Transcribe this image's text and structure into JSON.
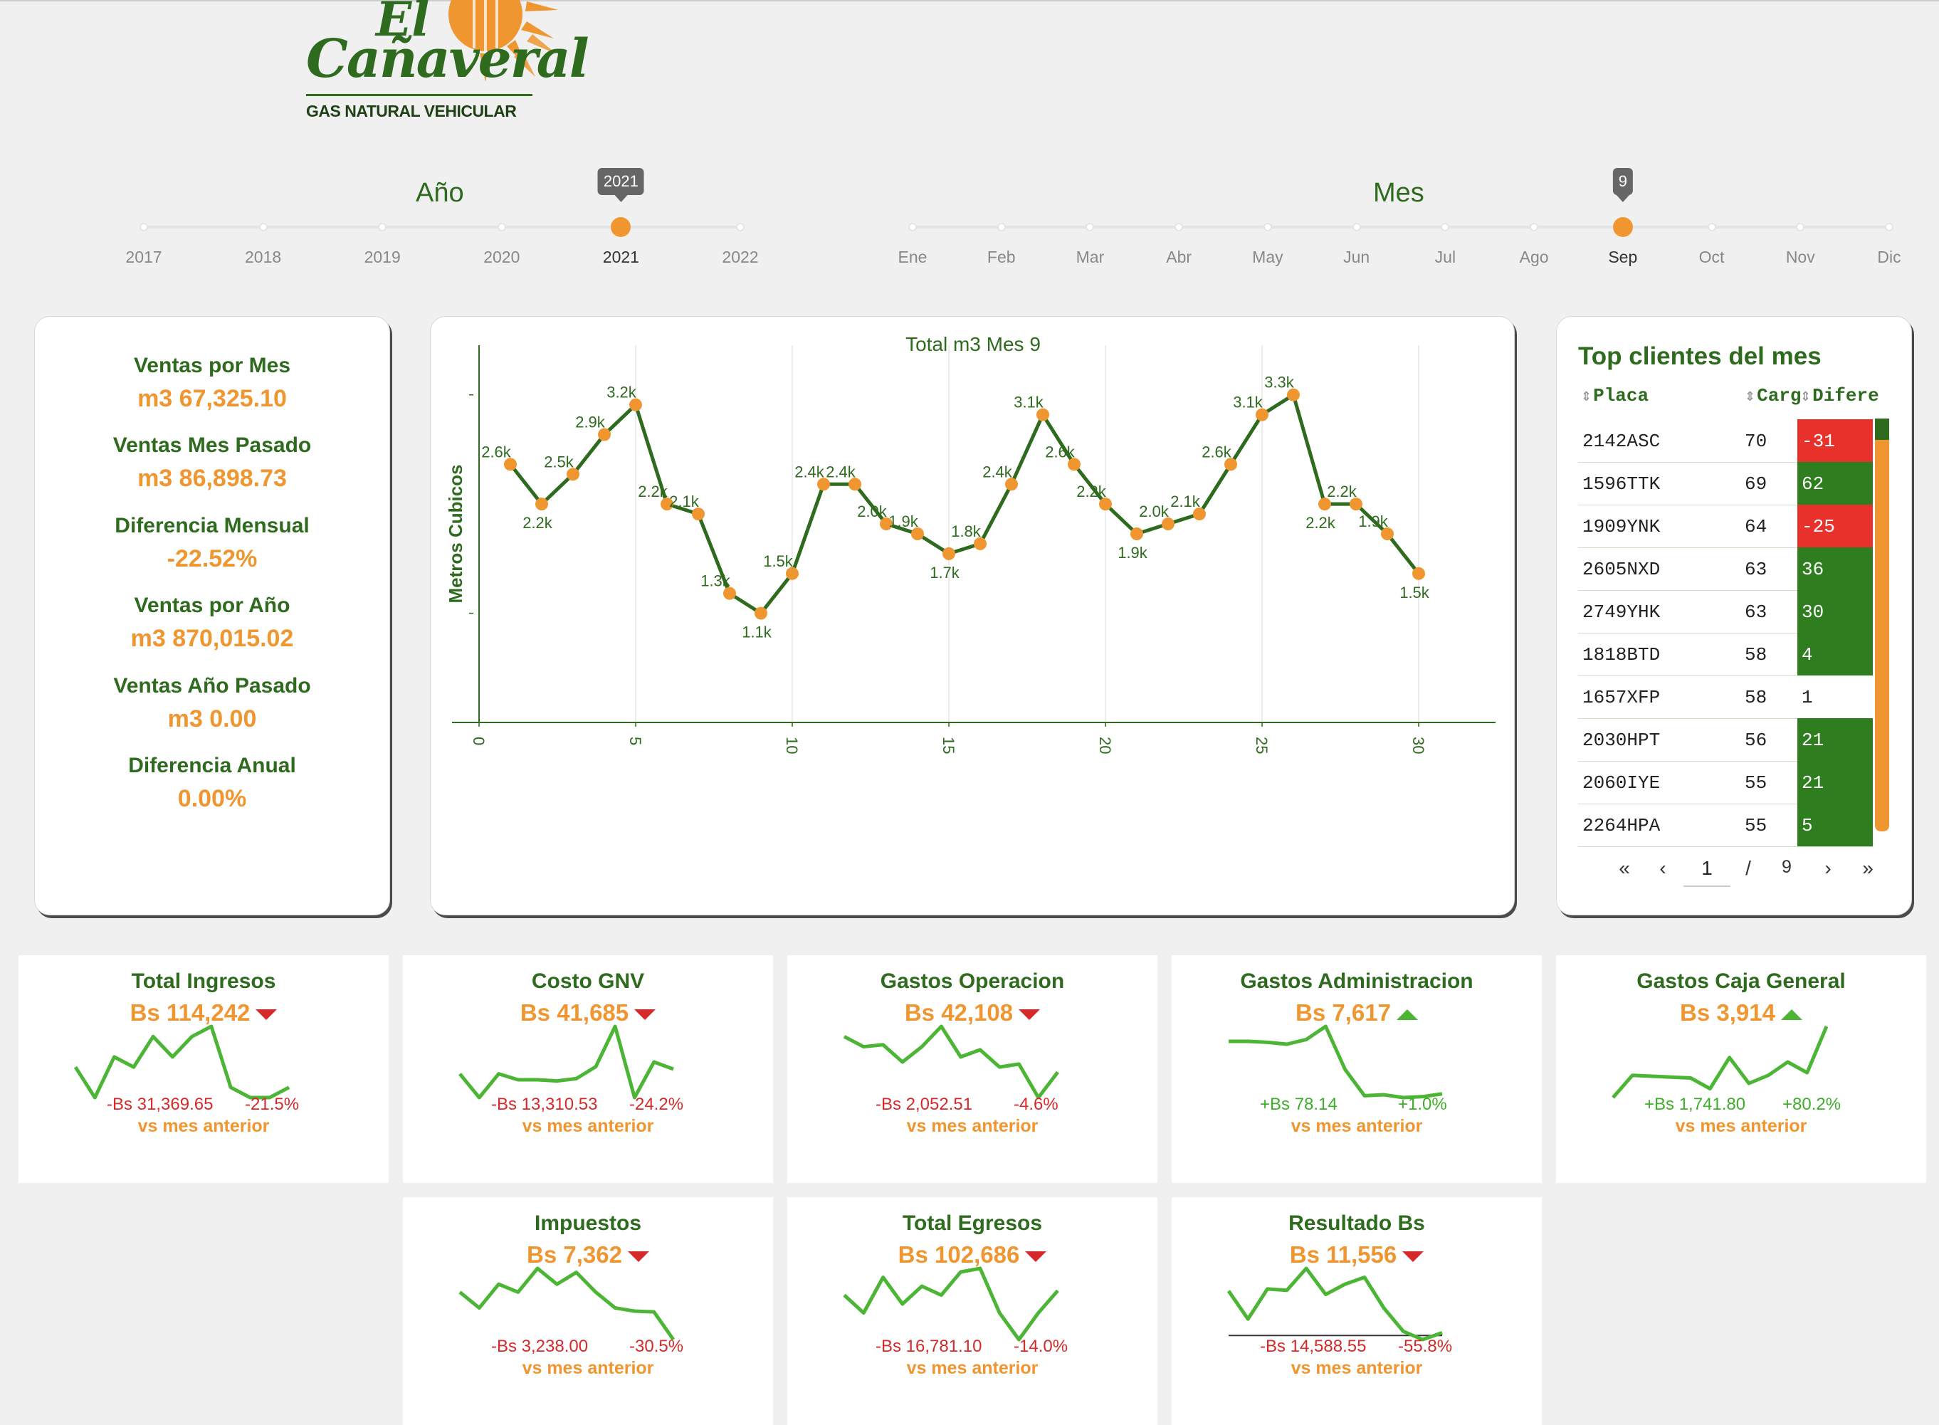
{
  "logo": {
    "line1": "El",
    "line2": "Cañaveral",
    "tagline": "GAS NATURAL VEHICULAR"
  },
  "colors": {
    "green": "#2e6b1f",
    "orange": "#ef9630",
    "red": "#e8312a",
    "dark_green": "#2e7d1e",
    "spark": "#4cb536"
  },
  "year_slider": {
    "title": "Año",
    "labels": [
      "2017",
      "2018",
      "2019",
      "2020",
      "2021",
      "2022"
    ],
    "selected_index": 4,
    "tooltip": "2021"
  },
  "month_slider": {
    "title": "Mes",
    "labels": [
      "Ene",
      "Feb",
      "Mar",
      "Abr",
      "May",
      "Jun",
      "Jul",
      "Ago",
      "Sep",
      "Oct",
      "Nov",
      "Dic"
    ],
    "selected_index": 8,
    "tooltip": "9"
  },
  "summary": {
    "ventas_mes_label": "Ventas por Mes",
    "ventas_mes_value": "m3 67,325.10",
    "ventas_mes_pasado_label": "Ventas Mes Pasado",
    "ventas_mes_pasado_value": "m3 86,898.73",
    "diferencia_mensual_label": "Diferencia Mensual",
    "diferencia_mensual_value": "-22.52%",
    "ventas_anio_label": "Ventas por Año",
    "ventas_anio_value": "m3 870,015.02",
    "ventas_anio_pasado_label": "Ventas Año Pasado",
    "ventas_anio_pasado_value": "m3 0.00",
    "diferencia_anual_label": "Diferencia Anual",
    "diferencia_anual_value": "0.00%"
  },
  "chart_data": {
    "type": "line",
    "title": "Total m3 Mes 9",
    "xlabel": "",
    "ylabel": "Metros Cubicos",
    "x": [
      1,
      2,
      3,
      4,
      5,
      6,
      7,
      8,
      9,
      10,
      11,
      12,
      13,
      14,
      15,
      16,
      17,
      18,
      19,
      20,
      21,
      22,
      23,
      24,
      25,
      26,
      27,
      28,
      29,
      30
    ],
    "values": [
      2600,
      2200,
      2500,
      2900,
      3200,
      2200,
      2100,
      1300,
      1100,
      1500,
      2400,
      2400,
      2000,
      1900,
      1700,
      1800,
      2400,
      3100,
      2600,
      2200,
      1900,
      2000,
      2100,
      2600,
      3100,
      3300,
      2200,
      2200,
      1900,
      1500
    ],
    "data_labels": [
      "2.6k",
      "2.2k",
      "2.5k",
      "2.9k",
      "3.2k",
      "2.2k",
      "2.1k",
      "1.3k",
      "1.1k",
      "1.5k",
      "2.4k",
      "2.4k",
      "2.0k",
      "1.9k",
      "1.7k",
      "1.8k",
      "2.4k",
      "3.1k",
      "2.6k",
      "2.2k",
      "1.9k",
      "2.0k",
      "2.1k",
      "2.6k",
      "3.1k",
      "3.3k",
      "2.2k",
      "2.2k",
      "1.9k",
      "1.5k"
    ],
    "xticks": [
      "0",
      "5",
      "10",
      "15",
      "20",
      "25",
      "30"
    ],
    "xlim": [
      0,
      32
    ],
    "ylim": [
      0,
      3800
    ],
    "grid": "vertical"
  },
  "top_clients": {
    "title": "Top clientes del mes",
    "headers": [
      "Placa",
      "Carg",
      "Difere"
    ],
    "rows": [
      {
        "placa": "2142ASC",
        "carg": "70",
        "dif": "-31",
        "sign": "neg"
      },
      {
        "placa": "1596TTK",
        "carg": "69",
        "dif": "62",
        "sign": "pos"
      },
      {
        "placa": "1909YNK",
        "carg": "64",
        "dif": "-25",
        "sign": "neg"
      },
      {
        "placa": "2605NXD",
        "carg": "63",
        "dif": "36",
        "sign": "pos"
      },
      {
        "placa": "2749YHK",
        "carg": "63",
        "dif": "30",
        "sign": "pos"
      },
      {
        "placa": "1818BTD",
        "carg": "58",
        "dif": "4",
        "sign": "pos"
      },
      {
        "placa": "1657XFP",
        "carg": "58",
        "dif": "1",
        "sign": "zero"
      },
      {
        "placa": "2030HPT",
        "carg": "56",
        "dif": "21",
        "sign": "pos"
      },
      {
        "placa": "2060IYE",
        "carg": "55",
        "dif": "21",
        "sign": "pos"
      },
      {
        "placa": "2264HPA",
        "carg": "55",
        "dif": "5",
        "sign": "pos"
      }
    ],
    "pager": {
      "first": "«",
      "prev": "‹",
      "current": "1",
      "sep": "/",
      "total": "9",
      "next": "›",
      "last": "»"
    }
  },
  "kpis": [
    {
      "title": "Total Ingresos",
      "value": "Bs 114,242",
      "trend": "down",
      "delta": "-Bs 31,369.65",
      "pct": "-21.5%",
      "caption": "vs mes anterior",
      "spark": [
        6,
        3,
        7,
        6,
        9,
        7,
        9,
        10,
        4,
        3,
        3,
        4
      ]
    },
    {
      "title": "Costo GNV",
      "value": "Bs 41,685",
      "trend": "down",
      "delta": "-Bs 13,310.53",
      "pct": "-24.2%",
      "caption": "vs mes anterior",
      "spark": [
        6,
        4,
        6,
        5.5,
        5.5,
        5.4,
        5.6,
        6.6,
        10,
        4,
        7,
        6.4
      ]
    },
    {
      "title": "Gastos Operacion",
      "value": "Bs 42,108",
      "trend": "down",
      "delta": "-Bs 2,052.51",
      "pct": "-4.6%",
      "caption": "vs mes anterior",
      "spark": [
        9,
        8,
        8.2,
        6.5,
        8,
        10,
        7,
        7.7,
        6,
        6.3,
        3,
        5.5
      ]
    },
    {
      "title": "Gastos Administracion",
      "value": "Bs 7,617",
      "trend": "up",
      "delta": "+Bs 78.14",
      "pct": "+1.0%",
      "caption": "vs mes anterior",
      "spark": [
        7,
        7,
        6.9,
        6.7,
        7.2,
        8.6,
        4,
        1.2,
        1.3,
        1,
        1.1,
        1.4
      ]
    },
    {
      "title": "Gastos Caja General",
      "value": "Bs 3,914",
      "trend": "up",
      "delta": "+Bs 1,741.80",
      "pct": "+80.2%",
      "caption": "vs mes anterior",
      "spark": [
        2,
        4.5,
        4.4,
        4.3,
        4.2,
        3,
        6.5,
        3.6,
        4.5,
        6,
        4.8,
        10
      ]
    },
    {
      "title": "Impuestos",
      "value": "Bs 7,362",
      "trend": "down",
      "delta": "-Bs 3,238.00",
      "pct": "-30.5%",
      "caption": "vs mes anterior",
      "spark": [
        7,
        5,
        8,
        7,
        10,
        8,
        9.5,
        7,
        5,
        4.6,
        4.5,
        1
      ]
    },
    {
      "title": "Total Egresos",
      "value": "Bs 102,686",
      "trend": "down",
      "delta": "-Bs 16,781.10",
      "pct": "-14.0%",
      "caption": "vs mes anterior",
      "spark": [
        6,
        4,
        8,
        5,
        7,
        6,
        8.6,
        9,
        4,
        1,
        4,
        6.5
      ]
    },
    {
      "title": "Resultado Bs",
      "value": "Bs 11,556",
      "trend": "down",
      "delta": "-Bs 14,588.55",
      "pct": "-55.8%",
      "caption": "vs mes anterior",
      "spark": [
        6.5,
        2.4,
        6.8,
        6.6,
        9.8,
        6,
        7.5,
        8.5,
        4,
        0.6,
        -0.6,
        0.4
      ]
    }
  ]
}
